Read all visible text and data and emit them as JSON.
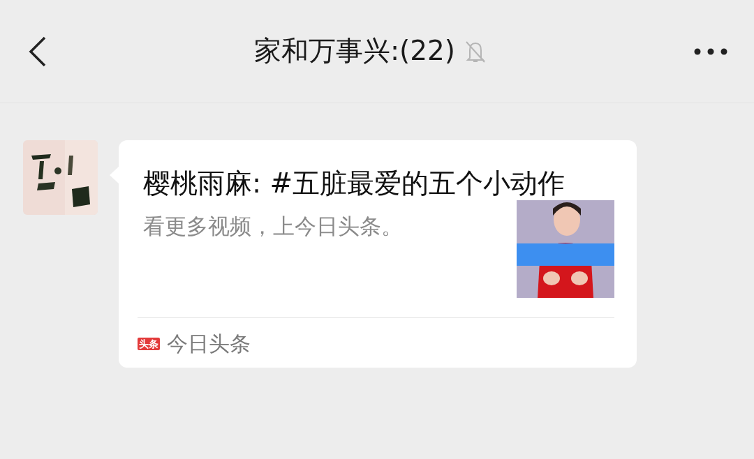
{
  "header": {
    "title": "家和万事兴:(22)",
    "muted": true
  },
  "message": {
    "card": {
      "title": "樱桃雨麻: #五脏最爱的五个小动作",
      "description": "看更多视频，上今日头条。",
      "source_badge": "头条",
      "source": "今日头条"
    }
  }
}
